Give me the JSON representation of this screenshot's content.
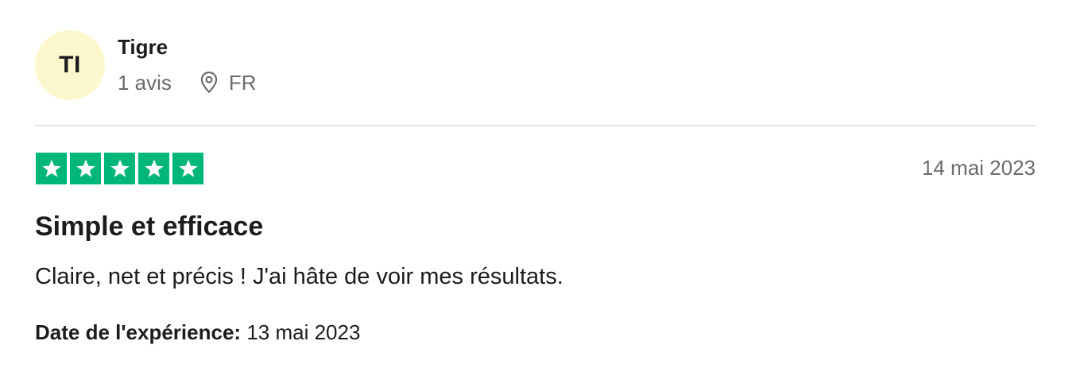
{
  "reviewer": {
    "initials": "TI",
    "name": "Tigre",
    "review_count": "1 avis",
    "country": "FR",
    "avatar_color": "#fcf7cd"
  },
  "review": {
    "rating": 5,
    "rating_max": 5,
    "star_color": "#00b67a",
    "date": "14 mai 2023",
    "title": "Simple et efficace",
    "body": "Claire, net et précis ! J'ai hâte de voir mes résultats.",
    "experience_label": "Date de l'expérience:",
    "experience_date": "13 mai 2023"
  },
  "icons": {
    "location": "location-pin-icon",
    "star": "star-icon"
  }
}
